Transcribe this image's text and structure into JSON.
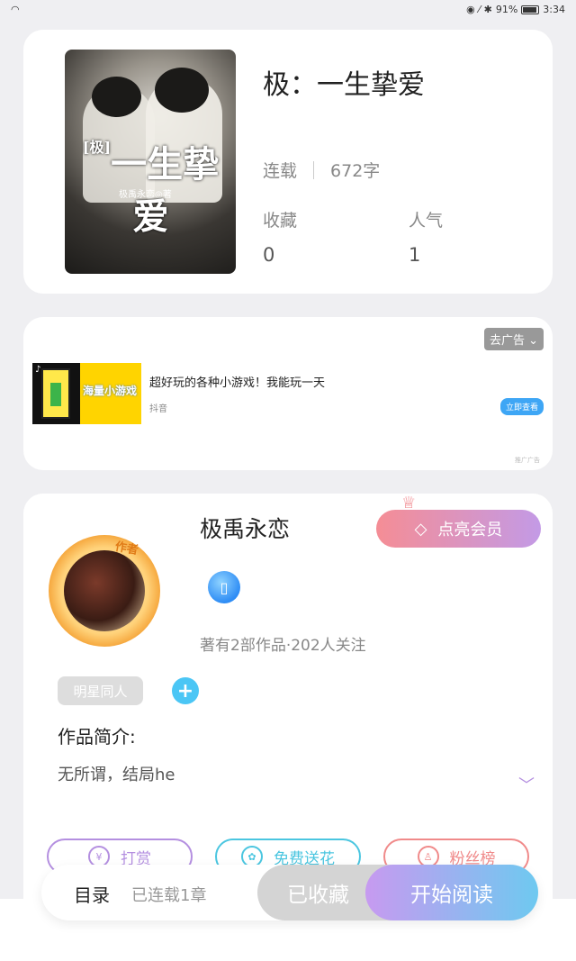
{
  "status_bar": {
    "battery": "91%",
    "time": "3:34"
  },
  "book": {
    "cover_title": "一生挚爱",
    "cover_prefix": "[极]",
    "cover_author": "极禹永恋◎著",
    "title": "极：一生挚爱",
    "serial_status": "连载",
    "word_count": "672字",
    "favorites_label": "收藏",
    "favorites_value": "0",
    "popularity_label": "人气",
    "popularity_value": "1"
  },
  "ad": {
    "remove_label": "去广告",
    "image_text": "海量小游戏",
    "text": "超好玩的各种小游戏！我能玩一天",
    "source": "抖音",
    "cta": "立即查看",
    "mark": "推广广告"
  },
  "author": {
    "badge": "作者",
    "name": "极禹永恋",
    "vip_label": "点亮会员",
    "works": "著有2部作品·202人关注",
    "tag": "明星同人",
    "intro_title": "作品简介:",
    "intro_text": "无所谓，结局he",
    "actions": [
      {
        "label": "打赏",
        "color": "#b48fe0",
        "icon": "¥"
      },
      {
        "label": "免费送花",
        "color": "#4bc6e0",
        "icon": "✿"
      },
      {
        "label": "粉丝榜",
        "color": "#f08a8a",
        "icon": "♙"
      }
    ]
  },
  "bottom_bar": {
    "toc_label": "目录",
    "chapters": "已连载1章",
    "favorited_label": "已收藏",
    "read_label": "开始阅读"
  }
}
